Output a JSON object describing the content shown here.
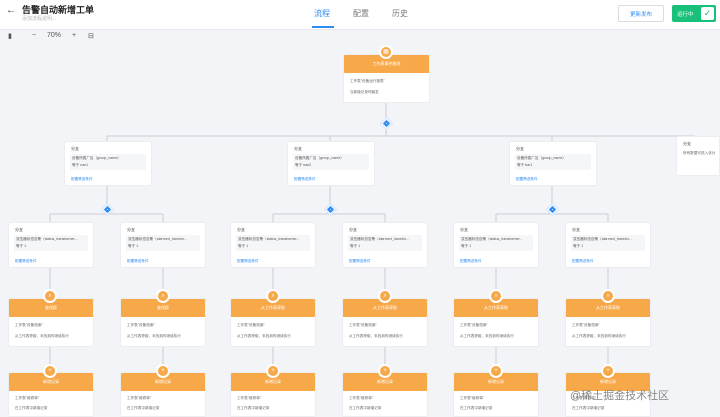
{
  "header": {
    "back_icon": "arrow-left-icon",
    "title": "告警自动新增工单",
    "subtitle": "添加流程说明...",
    "tabs": [
      {
        "label": "流程"
      },
      {
        "label": "配置"
      },
      {
        "label": "历史"
      }
    ],
    "active_tab": "流程",
    "publish_label": "更新发布",
    "running_label": "运行中",
    "accent": "#2d8cf0",
    "running_color": "#18c07a"
  },
  "toolbar": {
    "map_icon": "map-icon",
    "zoom_out": "−",
    "zoom": "70%",
    "zoom_in": "+",
    "fit_icon": "fit-view-icon"
  },
  "trigger": {
    "title": "工作表事件触发",
    "line1": "工作表\"设备运行报表\"",
    "line2": "当新增记录时触发"
  },
  "branches": [
    {
      "title": "分支",
      "field": "设备所属厂区（group_name）",
      "cond": "等于 nan1",
      "link": "配置筛选条件"
    },
    {
      "title": "分支",
      "field": "设备所属厂区（group_name）",
      "cond": "等于 nan2",
      "link": "配置筛选条件"
    },
    {
      "title": "分支",
      "field": "设备所属厂区（group_name）",
      "cond": "等于 bar1",
      "link": "配置筛选条件"
    },
    {
      "title": "分支",
      "field": "所有数据可进入该分",
      "cond": "",
      "link": ""
    }
  ],
  "sub_branches": [
    {
      "title": "分支",
      "field": "变压器状态告警（status_transformer...",
      "cond": "等于 1",
      "link": "配置筛选条件"
    },
    {
      "title": "分支",
      "field": "变压器状态告警（alarmed_transfor...",
      "cond": "等于 1",
      "link": "配置筛选条件"
    },
    {
      "title": "分支",
      "field": "变压器状态告警（status_transformer...",
      "cond": "等于 1",
      "link": "配置筛选条件"
    },
    {
      "title": "分支",
      "field": "变压器状态告警（alarmed_transfor...",
      "cond": "等于 1",
      "link": "配置筛选条件"
    },
    {
      "title": "分支",
      "field": "变压器状态告警（status_transformer...",
      "cond": "等于 1",
      "link": "配置筛选条件"
    },
    {
      "title": "分支",
      "field": "变压器状态告警（alarmed_transfor...",
      "cond": "等于 1",
      "link": "配置筛选条件"
    }
  ],
  "lookup_nodes": [
    {
      "title": "查找群",
      "line1": "工作表\"设备档案\"",
      "line2": "从工作表获取，未找到时继续执行"
    },
    {
      "title": "查找群",
      "line1": "工作表\"设备档案\"",
      "line2": "从工作表获取，未找到时继续执行"
    },
    {
      "title": "从工作表获取",
      "line1": "工作表\"设备档案\"",
      "line2": "从工作表获取，未找到时继续执行"
    },
    {
      "title": "从工作表获取",
      "line1": "工作表\"设备档案\"",
      "line2": "从工作表获取，未找到时继续执行"
    },
    {
      "title": "从工作表获取",
      "line1": "工作表\"设备档案\"",
      "line2": "从工作表获取，未找到时继续执行"
    },
    {
      "title": "从工作表获取",
      "line1": "工作表\"设备档案\"",
      "line2": "从工作表获取，未找到时继续执行"
    }
  ],
  "create_nodes": [
    {
      "title": "新增记录",
      "line1": "工作表\"维修单\"",
      "line2": "在工作表中新增记录"
    },
    {
      "title": "新增记录",
      "line1": "工作表\"维修单\"",
      "line2": "在工作表中新增记录"
    },
    {
      "title": "新增记录",
      "line1": "工作表\"维修单\"",
      "line2": "在工作表中新增记录"
    },
    {
      "title": "新增记录",
      "line1": "工作表\"维修单\"",
      "line2": "在工作表中新增记录"
    },
    {
      "title": "新增记录",
      "line1": "工作表\"维修单\"",
      "line2": "在工作表中新增记录"
    },
    {
      "title": "新增记录",
      "line1": "工作表\"维修单\"",
      "line2": "在工作表中新增记录"
    }
  ],
  "watermark": "@稀土掘金技术社区",
  "colors": {
    "node_orange": "#f7a94a",
    "link_blue": "#2d8cf0",
    "canvas": "#f3f4f7",
    "connector": "#c9cdd4"
  }
}
